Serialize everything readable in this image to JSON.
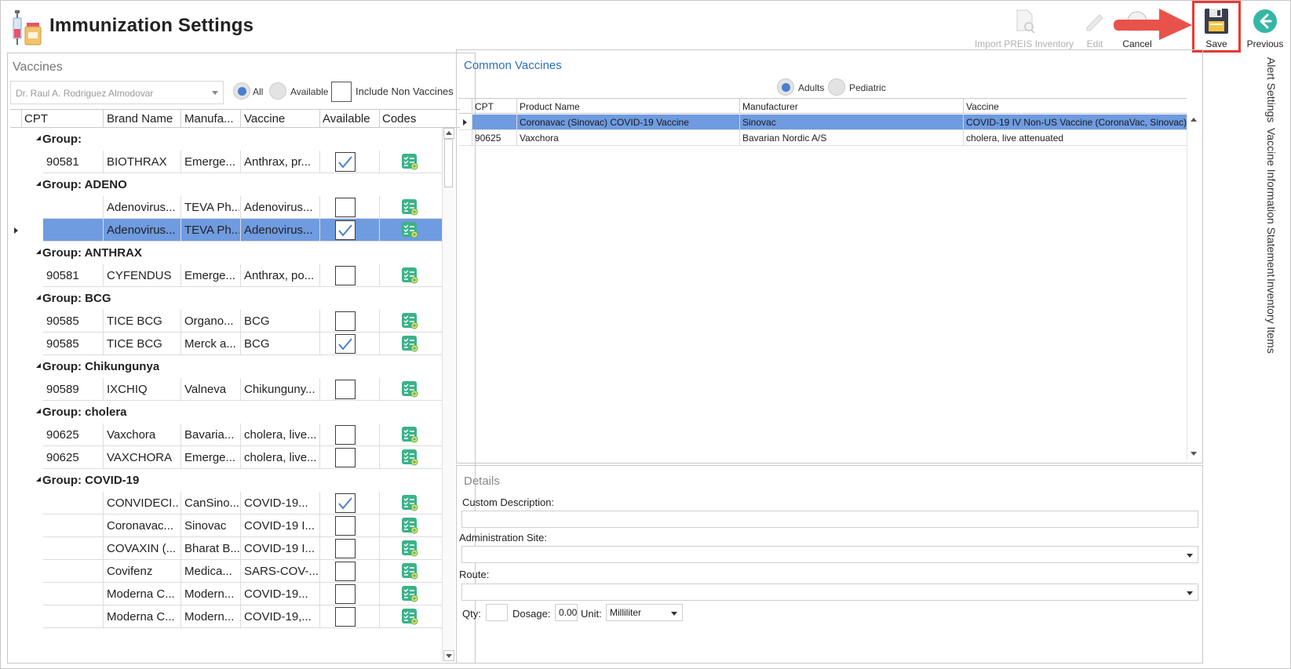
{
  "header": {
    "title": "Immunization Settings"
  },
  "toolbar": {
    "import": "Import PREIS Inventory",
    "edit": "Edit",
    "cancel": "Cancel",
    "save": "Save",
    "previous": "Previous"
  },
  "side_tabs": [
    "Alert Settings",
    "Vaccine Information Statement",
    "Inventory Items"
  ],
  "vaccines_panel": {
    "title": "Vaccines",
    "provider_placeholder": "Dr. Raul A. Rodriguez Almodovar",
    "filter_all": "All",
    "filter_available": "Available",
    "include_non_vaccines": "Include Non Vaccines",
    "columns": [
      "CPT",
      "Brand Name",
      "Manufa...",
      "Vaccine",
      "Available",
      "Codes"
    ],
    "rows": [
      {
        "type": "group",
        "label": "Group:"
      },
      {
        "type": "item",
        "cpt": "90581",
        "brand": "BIOTHRAX",
        "manu": "Emerge...",
        "vaccine": "Anthrax, pr...",
        "available": true
      },
      {
        "type": "group",
        "label": "Group: ADENO"
      },
      {
        "type": "item",
        "cpt": "",
        "brand": "Adenovirus...",
        "manu": "TEVA Ph...",
        "vaccine": "Adenovirus...",
        "available": false
      },
      {
        "type": "item",
        "cpt": "",
        "brand": "Adenovirus...",
        "manu": "TEVA Ph...",
        "vaccine": "Adenovirus...",
        "available": true,
        "selected": true
      },
      {
        "type": "group",
        "label": "Group: ANTHRAX"
      },
      {
        "type": "item",
        "cpt": "90581",
        "brand": "CYFENDUS",
        "manu": "Emerge...",
        "vaccine": "Anthrax, po...",
        "available": false
      },
      {
        "type": "group",
        "label": "Group: BCG"
      },
      {
        "type": "item",
        "cpt": "90585",
        "brand": "TICE BCG",
        "manu": "Organo...",
        "vaccine": "BCG",
        "available": false
      },
      {
        "type": "item",
        "cpt": "90585",
        "brand": "TICE BCG",
        "manu": "Merck a...",
        "vaccine": "BCG",
        "available": true
      },
      {
        "type": "group",
        "label": "Group: Chikungunya"
      },
      {
        "type": "item",
        "cpt": "90589",
        "brand": "IXCHIQ",
        "manu": "Valneva",
        "vaccine": "Chikunguny...",
        "available": false
      },
      {
        "type": "group",
        "label": "Group: cholera"
      },
      {
        "type": "item",
        "cpt": "90625",
        "brand": "Vaxchora",
        "manu": "Bavaria...",
        "vaccine": "cholera, live...",
        "available": false
      },
      {
        "type": "item",
        "cpt": "90625",
        "brand": "VAXCHORA",
        "manu": "Emerge...",
        "vaccine": "cholera, live...",
        "available": false
      },
      {
        "type": "group",
        "label": "Group: COVID-19"
      },
      {
        "type": "item",
        "cpt": "",
        "brand": "CONVIDECI...",
        "manu": "CanSino...",
        "vaccine": "COVID-19...",
        "available": true
      },
      {
        "type": "item",
        "cpt": "",
        "brand": "Coronavac...",
        "manu": "Sinovac",
        "vaccine": "COVID-19 I...",
        "available": false
      },
      {
        "type": "item",
        "cpt": "",
        "brand": "COVAXIN (...",
        "manu": "Bharat B...",
        "vaccine": "COVID-19 I...",
        "available": false
      },
      {
        "type": "item",
        "cpt": "",
        "brand": "Covifenz",
        "manu": "Medica...",
        "vaccine": "SARS-COV-...",
        "available": false
      },
      {
        "type": "item",
        "cpt": "",
        "brand": "Moderna C...",
        "manu": "Modern...",
        "vaccine": "COVID-19...",
        "available": false
      },
      {
        "type": "item",
        "cpt": "",
        "brand": "Moderna C...",
        "manu": "Modern...",
        "vaccine": "COVID-19,...",
        "available": false
      }
    ]
  },
  "common_vaccines": {
    "title": "Common Vaccines",
    "filter_adults": "Adults",
    "filter_pediatric": "Pediatric",
    "columns": [
      "CPT",
      "Product Name",
      "Manufacturer",
      "Vaccine"
    ],
    "rows": [
      {
        "cpt": "",
        "product": "Coronavac (Sinovac) COVID-19 Vaccine",
        "manufacturer": "Sinovac",
        "vaccine": "COVID-19 IV Non-US Vaccine (CoronaVac, Sinovac)",
        "selected": true
      },
      {
        "cpt": "90625",
        "product": "Vaxchora",
        "manufacturer": "Bavarian Nordic A/S",
        "vaccine": "cholera, live attenuated",
        "selected": false
      }
    ]
  },
  "details": {
    "title": "Details",
    "custom_description_label": "Custom Description:",
    "custom_description_value": "",
    "administration_site_label": "Administration Site:",
    "administration_site_value": "",
    "route_label": "Route:",
    "route_value": "",
    "qty_label": "Qty:",
    "qty_value": "",
    "dosage_label": "Dosage:",
    "dosage_value": "0.00",
    "unit_label": "Unit:",
    "unit_value": "Milliliter"
  },
  "colors": {
    "selection": "#6f9be0",
    "accent_blue": "#2d6fc1",
    "highlight_red": "#e33b35",
    "codes_icon": "#3cb28a"
  },
  "icons": {
    "app": "syringe-vial-icon",
    "import": "document-search-icon",
    "edit": "pencil-icon",
    "cancel": "cancel-icon",
    "save": "floppy-disk-icon",
    "previous": "back-arrow-icon",
    "codes": "checklist-add-icon"
  }
}
